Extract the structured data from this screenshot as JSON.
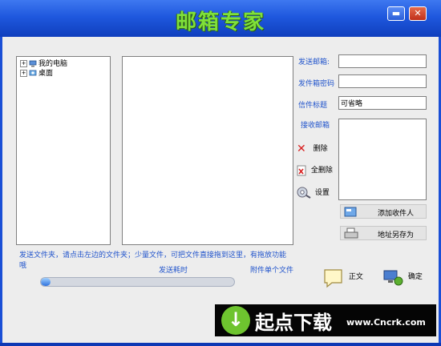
{
  "window": {
    "title": "邮箱专家",
    "minimize_icon": "minimize-icon",
    "close_icon": "close-icon"
  },
  "tree": {
    "items": [
      {
        "label": "我的电脑",
        "icon": "computer-icon"
      },
      {
        "label": "桌面",
        "icon": "desktop-icon"
      }
    ]
  },
  "form": {
    "sender_label": "发送邮箱:",
    "sender_value": "",
    "password_label": "发件箱密码",
    "password_value": "",
    "subject_label": "信件标题",
    "subject_value": "可省略",
    "recipients_label": "接收邮箱"
  },
  "buttons": {
    "delete": "删除",
    "delete_all": "全删除",
    "settings": "设置",
    "add_recipient": "添加收件人",
    "save_address": "地址另存为",
    "body": "正文",
    "confirm": "确定"
  },
  "hints": {
    "folder_hint": "发送文件夹，请点击左边的文件夹；少量文件，可把文件直接拖到这里，有拖放功能哦",
    "send_time": "发送耗时",
    "attach_single": "附件单个文件"
  },
  "progress": {
    "value": 0.03
  },
  "banner": {
    "brand": "起点下载",
    "url": "www.Cncrk.com"
  },
  "colors": {
    "title_green": "#7fe03a",
    "titlebar_blue": "#1f58de",
    "label_blue": "#2255cc"
  }
}
